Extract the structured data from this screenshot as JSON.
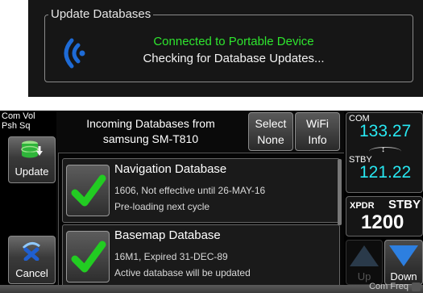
{
  "status": {
    "title": "Update Databases",
    "line1": "Connected to Portable Device",
    "line2": "Checking for Database Updates..."
  },
  "left": {
    "vol_label_1": "Com Vol",
    "vol_label_2": "Psh Sq",
    "update_label": "Update",
    "cancel_label": "Cancel"
  },
  "header": {
    "line1": "Incoming Databases from",
    "line2": "samsung SM-T810"
  },
  "buttons": {
    "select_1": "Select",
    "select_2": "None",
    "wifi_1": "WiFi",
    "wifi_2": "Info"
  },
  "databases": [
    {
      "name": "Navigation Database",
      "line1": "1606, Not effective until 26-MAY-16",
      "line2": "Pre-loading next cycle"
    },
    {
      "name": "Basemap Database",
      "line1": "16M1, Expired 31-DEC-89",
      "line2": "Active database will be updated"
    }
  ],
  "radio": {
    "com_label": "COM",
    "com_freq": "133.27",
    "stby_label": "STBY",
    "stby_freq": "121.22",
    "xpdr_label": "XPDR",
    "xpdr_mode": "STBY",
    "xpdr_code": "1200",
    "up_label": "Up",
    "down_label": "Down",
    "com_freq_label": "Com Freq"
  },
  "colors": {
    "status_connected": "#2ee52e",
    "frequency": "#28e8f2",
    "check": "#22cc22"
  }
}
